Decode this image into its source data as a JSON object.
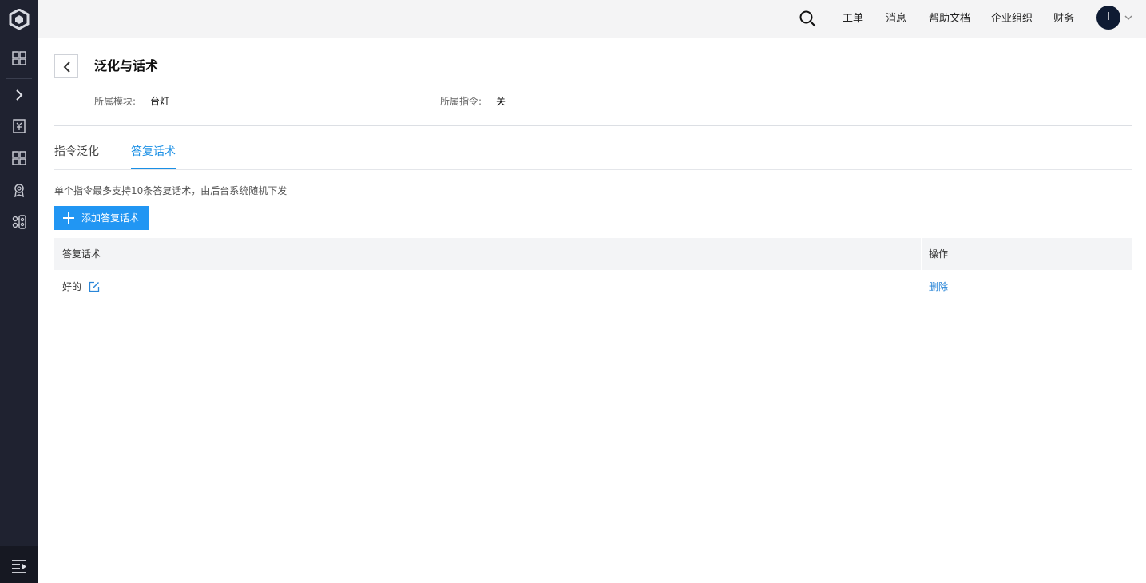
{
  "topbar": {
    "nav": [
      "工单",
      "消息",
      "帮助文档",
      "企业组织",
      "财务"
    ],
    "avatar_initial": "I"
  },
  "sidebar": {
    "icons": [
      "logo-icon",
      "grid-icon",
      "expand-chevron-icon",
      "receipt-icon",
      "apps-icon",
      "badge-icon",
      "cluster-icon",
      "menu-collapse-icon"
    ]
  },
  "page": {
    "title": "泛化与话术",
    "module_label": "所属模块:",
    "module_value": "台灯",
    "command_label": "所属指令:",
    "command_value": "关"
  },
  "tabs": [
    {
      "label": "指令泛化",
      "active": false
    },
    {
      "label": "答复话术",
      "active": true
    }
  ],
  "hint": "单个指令最多支持10条答复话术，由后台系统随机下发",
  "add_button": "添加答复话术",
  "table": {
    "columns": [
      "答复话术",
      "操作"
    ],
    "rows": [
      {
        "reply": "好的",
        "action": "删除"
      }
    ]
  },
  "colors": {
    "accent": "#2196f3",
    "tab_active": "#1a8fe5",
    "sidebar_bg": "#1f2230"
  }
}
